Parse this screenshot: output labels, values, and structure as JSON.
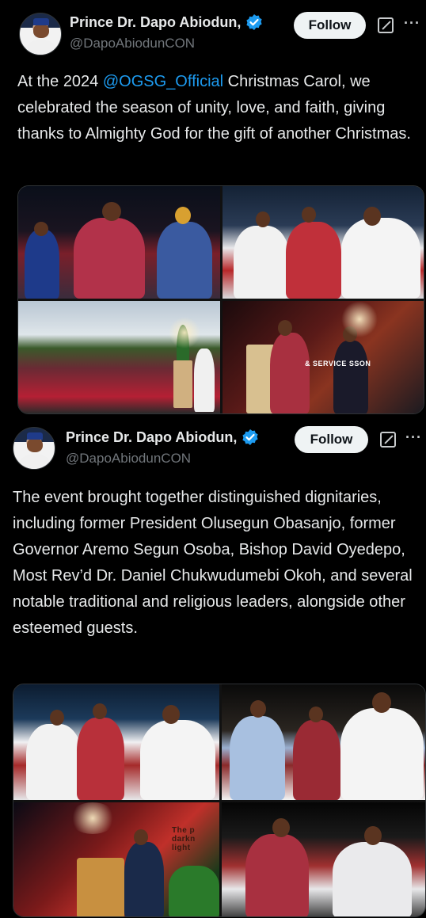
{
  "posts": [
    {
      "author": {
        "name": "Prince Dr. Dapo Abiodun,",
        "handle": "@DapoAbiodunCON",
        "verified": true
      },
      "follow_label": "Follow",
      "text_before": "At the 2024 ",
      "mention": "@OGSG_Official",
      "text_after": " Christmas Carol, we celebrated the season of unity, love, and faith, giving thanks to Almighty God for the gift of another Christmas.",
      "media_sign": "& SERVICE    SSON"
    },
    {
      "author": {
        "name": "Prince Dr. Dapo Abiodun,",
        "handle": "@DapoAbiodunCON",
        "verified": true
      },
      "follow_label": "Follow",
      "text": "The event brought together distinguished dignitaries, including former President Olusegun Obasanjo, former Governor Aremo Segun Osoba, Bishop David Oyedepo, Most Rev’d Dr. Daniel Chukwudumebi Okoh, and several notable traditional and religious leaders, alongside other esteemed guests.",
      "media_sign": "The p darkn light"
    }
  ],
  "colors": {
    "background": "#000000",
    "text": "#e7e9ea",
    "secondary": "#71767b",
    "link": "#1d9bf0",
    "verified": "#1d9bf0",
    "follow_bg": "#eff3f4"
  },
  "icons": [
    "verified-badge-icon",
    "grok-icon",
    "more-icon"
  ]
}
